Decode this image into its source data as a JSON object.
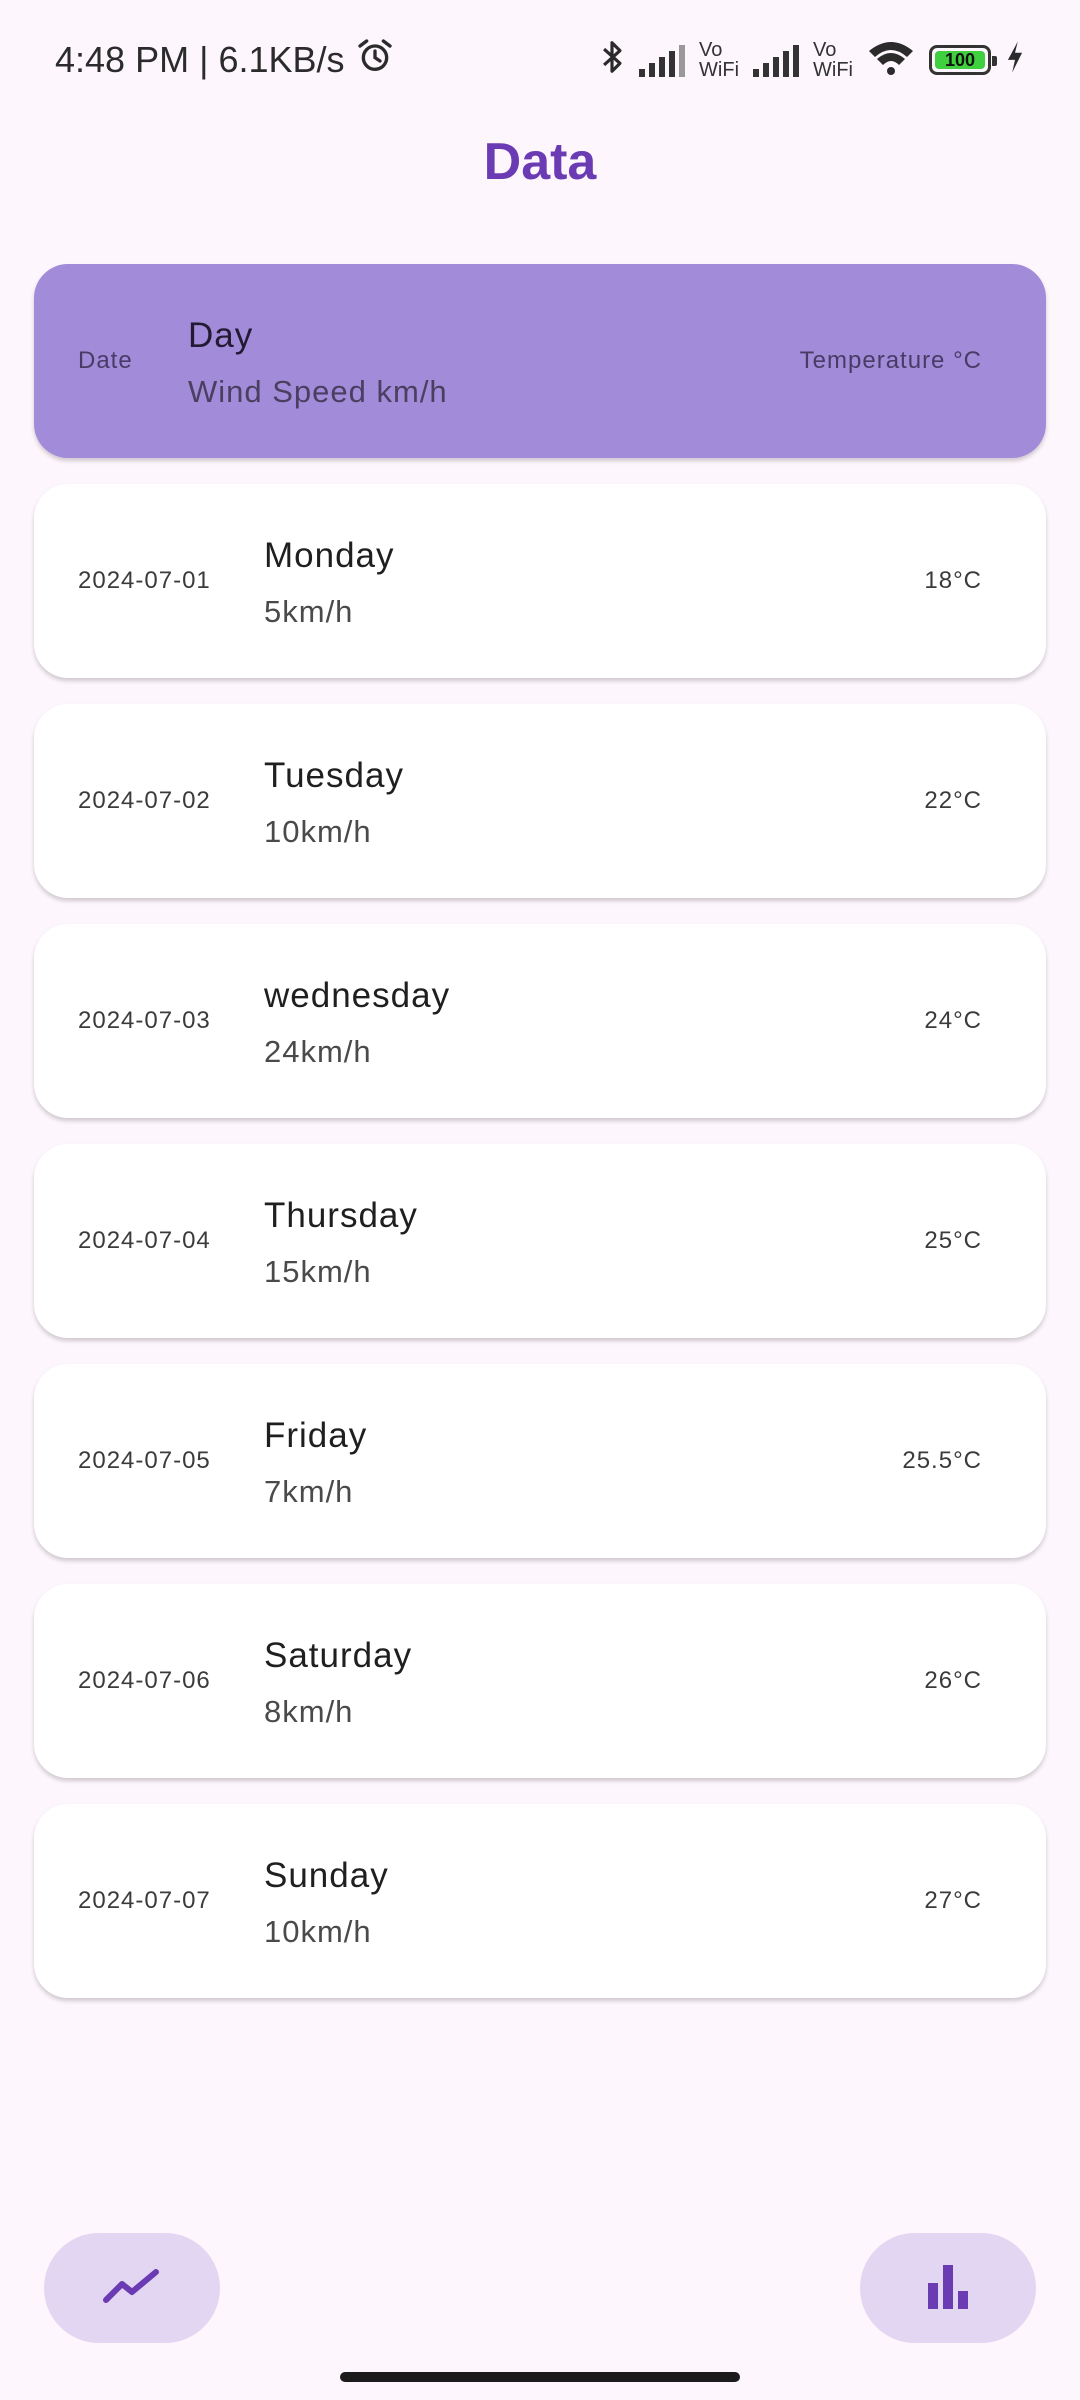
{
  "status_bar": {
    "time": "4:48 PM",
    "separator": "|",
    "speed": "6.1KB/s",
    "battery": "100",
    "vowifi_top": "Vo",
    "vowifi_bottom": "WiFi"
  },
  "page": {
    "title": "Data"
  },
  "header_row": {
    "date": "Date",
    "day": "Day",
    "wind": "Wind Speed km/h",
    "temp": "Temperature °C"
  },
  "rows": [
    {
      "date": "2024-07-01",
      "day": "Monday",
      "wind": "5km/h",
      "temp": "18°C"
    },
    {
      "date": "2024-07-02",
      "day": "Tuesday",
      "wind": "10km/h",
      "temp": "22°C"
    },
    {
      "date": "2024-07-03",
      "day": "wednesday",
      "wind": "24km/h",
      "temp": "24°C"
    },
    {
      "date": "2024-07-04",
      "day": "Thursday",
      "wind": "15km/h",
      "temp": "25°C"
    },
    {
      "date": "2024-07-05",
      "day": "Friday",
      "wind": "7km/h",
      "temp": "25.5°C"
    },
    {
      "date": "2024-07-06",
      "day": "Saturday",
      "wind": "8km/h",
      "temp": "26°C"
    },
    {
      "date": "2024-07-07",
      "day": "Sunday",
      "wind": "10km/h",
      "temp": "27°C"
    }
  ],
  "actions": {
    "left_icon": "line-chart-icon",
    "right_icon": "bar-chart-icon"
  },
  "colors": {
    "accent": "#6a3bb3",
    "header_card": "#a28bd8",
    "fab_bg": "#e2d6f2",
    "background": "#fdf6fd"
  }
}
